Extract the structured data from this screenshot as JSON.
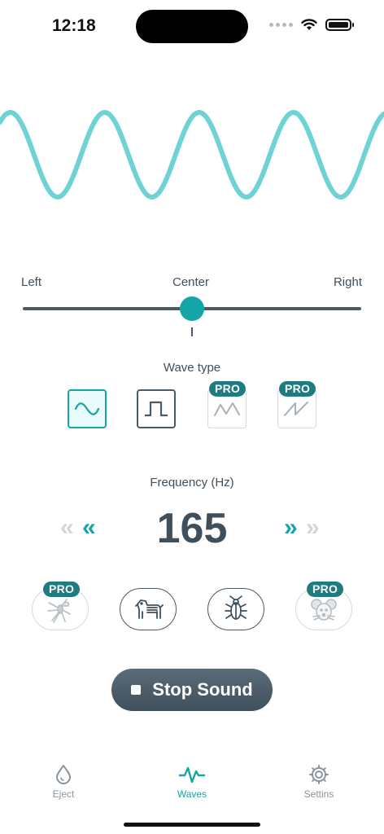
{
  "status_bar": {
    "time": "12:18"
  },
  "wave_display": {
    "color": "#6fd3d6",
    "cycles_visible": 5
  },
  "balance": {
    "left_label": "Left",
    "center_label": "Center",
    "right_label": "Right",
    "position": 0.5
  },
  "wave_type": {
    "label": "Wave type",
    "options": [
      {
        "name": "sine",
        "icon": "sine-wave-icon",
        "selected": true,
        "pro": false
      },
      {
        "name": "square",
        "icon": "square-wave-icon",
        "selected": false,
        "pro": false
      },
      {
        "name": "triangle",
        "icon": "triangle-wave-icon",
        "selected": false,
        "pro": true,
        "badge": "PRO"
      },
      {
        "name": "sawtooth",
        "icon": "sawtooth-wave-icon",
        "selected": false,
        "pro": true,
        "badge": "PRO"
      }
    ]
  },
  "frequency": {
    "label": "Frequency (Hz)",
    "value": "165",
    "decrease_big": "«",
    "decrease_small": "«",
    "increase_small": "»",
    "increase_big": "»"
  },
  "pests": [
    {
      "name": "mosquito",
      "icon": "mosquito-icon",
      "pro": true,
      "badge": "PRO"
    },
    {
      "name": "dog",
      "icon": "dog-icon",
      "pro": false
    },
    {
      "name": "cockroach",
      "icon": "cockroach-icon",
      "pro": false
    },
    {
      "name": "mouse",
      "icon": "mouse-icon",
      "pro": true,
      "badge": "PRO"
    }
  ],
  "stop_button": {
    "label": "Stop Sound"
  },
  "tabs": [
    {
      "label": "Eject",
      "icon": "droplet-icon",
      "active": false
    },
    {
      "label": "Waves",
      "icon": "pulse-wave-icon",
      "active": true
    },
    {
      "label": "Settins",
      "icon": "gear-icon",
      "active": false
    }
  ],
  "colors": {
    "accent": "#14a5a8",
    "dark": "#3f4f5c",
    "pro_badge": "#1f7b7f",
    "muted": "#d0d6db"
  }
}
